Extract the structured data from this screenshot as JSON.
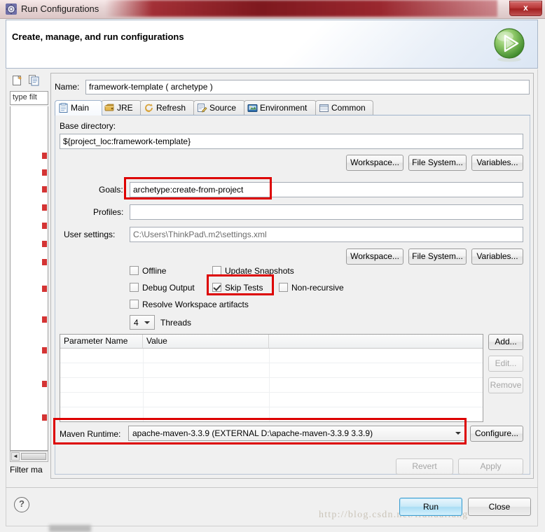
{
  "window": {
    "title": "Run Configurations",
    "title_icon": "run-config-gear-icon",
    "close_label": "x"
  },
  "header": {
    "title": "Create, manage, and run configurations",
    "icon": "green-run-play-icon"
  },
  "sidebar": {
    "new_button_icon": "new-launch-configuration-icon",
    "duplicate_button_icon": "duplicate-configuration-icon",
    "filter_value": "type filt",
    "filter_placeholder": "type filter text",
    "scroll_left_arrow": "◄",
    "status": "Filter ma"
  },
  "name": {
    "label": "Name:",
    "value": "framework-template ( archetype )"
  },
  "tabs": [
    {
      "label": "Main",
      "icon": "main-tab-icon",
      "active": true
    },
    {
      "label": "JRE",
      "icon": "jre-tab-icon",
      "active": false
    },
    {
      "label": "Refresh",
      "icon": "refresh-tab-icon",
      "active": false
    },
    {
      "label": "Source",
      "icon": "source-tab-icon",
      "active": false
    },
    {
      "label": "Environment",
      "icon": "environment-tab-icon",
      "active": false
    },
    {
      "label": "Common",
      "icon": "common-tab-icon",
      "active": false
    }
  ],
  "main": {
    "base_directory": {
      "label": "Base directory:",
      "value": "${project_loc:framework-template}"
    },
    "dir_buttons": [
      {
        "label": "Workspace..."
      },
      {
        "label": "File System..."
      },
      {
        "label": "Variables..."
      }
    ],
    "goals": {
      "label": "Goals:",
      "value": "archetype:create-from-project"
    },
    "profiles": {
      "label": "Profiles:",
      "value": ""
    },
    "user_settings": {
      "label": "User settings:",
      "value": "C:\\Users\\ThinkPad\\.m2\\settings.xml"
    },
    "settings_buttons": [
      {
        "label": "Workspace..."
      },
      {
        "label": "File System..."
      },
      {
        "label": "Variables..."
      }
    ],
    "checkboxes": [
      {
        "label": "Offline",
        "checked": false
      },
      {
        "label": "Update Snapshots",
        "checked": false
      },
      {
        "label": "Debug Output",
        "checked": false
      },
      {
        "label": "Skip Tests",
        "checked": true
      },
      {
        "label": "Non-recursive",
        "checked": false
      },
      {
        "label": "Resolve Workspace artifacts",
        "checked": false
      }
    ],
    "threads": {
      "value": "4",
      "label": "Threads"
    },
    "parameters_table": {
      "columns": [
        "Parameter Name",
        "Value",
        ""
      ],
      "rows": []
    },
    "table_buttons": [
      {
        "label": "Add...",
        "enabled": true
      },
      {
        "label": "Edit...",
        "enabled": false
      },
      {
        "label": "Remove",
        "enabled": false
      }
    ],
    "maven_runtime": {
      "label": "Maven Runtime:",
      "value": "apache-maven-3.3.9 (EXTERNAL D:\\apache-maven-3.3.9 3.3.9)",
      "configure_label": "Configure..."
    }
  },
  "actions": {
    "revert": "Revert",
    "apply": "Apply",
    "run": "Run",
    "close": "Close",
    "help_icon": "?"
  },
  "watermark": "http://blog.csdn.net/liuhuaiiang",
  "annotations": {
    "accent_color": "#dd0000",
    "boxes": [
      "goals-field",
      "skip-tests-checkbox",
      "maven-runtime-row"
    ]
  }
}
